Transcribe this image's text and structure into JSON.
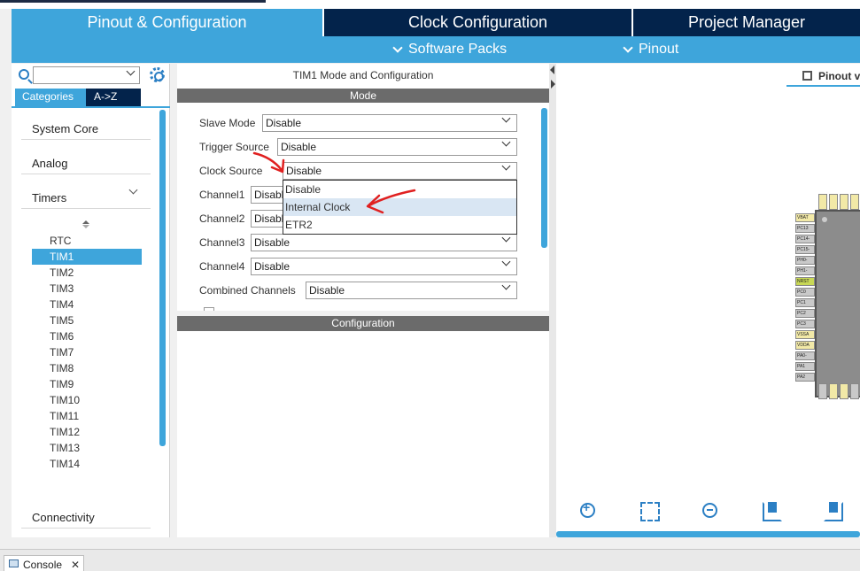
{
  "top_tabs": [
    {
      "label": "Pinout & Configuration"
    },
    {
      "label": "Clock Configuration"
    },
    {
      "label": "Project Manager"
    }
  ],
  "sub_menu": {
    "software_packs": "Software Packs",
    "pinout": "Pinout"
  },
  "sidebar": {
    "search_placeholder": "",
    "categories_label": "Categories",
    "az_label": "A->Z",
    "groups": [
      {
        "label": "System Core"
      },
      {
        "label": "Analog"
      },
      {
        "label": "Timers"
      },
      {
        "label": "Connectivity"
      }
    ],
    "timers": [
      "RTC",
      "TIM1",
      "TIM2",
      "TIM3",
      "TIM4",
      "TIM5",
      "TIM6",
      "TIM7",
      "TIM8",
      "TIM9",
      "TIM10",
      "TIM11",
      "TIM12",
      "TIM13",
      "TIM14"
    ],
    "selected_timer": "TIM1"
  },
  "mode_panel": {
    "title": "TIM1 Mode and Configuration",
    "mode_header": "Mode",
    "config_header": "Configuration",
    "fields": [
      {
        "label": "Slave Mode",
        "value": "Disable"
      },
      {
        "label": "Trigger Source",
        "value": "Disable"
      },
      {
        "label": "Clock Source",
        "value": "Disable"
      },
      {
        "label": "Channel1",
        "value": "Disable"
      },
      {
        "label": "Channel2",
        "value": "Disable"
      },
      {
        "label": "Channel3",
        "value": "Disable"
      },
      {
        "label": "Channel4",
        "value": "Disable"
      },
      {
        "label": "Combined Channels",
        "value": "Disable"
      }
    ],
    "dropdown_options": [
      "Disable",
      "Internal Clock",
      "ETR2"
    ],
    "dropdown_highlighted": "Internal Clock"
  },
  "pinout_view": {
    "tab_label": "Pinout v",
    "left_pins": [
      "VBAT",
      "PC13",
      "PC14-",
      "PC15-",
      "PH0-",
      "PH1-",
      "NRST",
      "PC0",
      "PC1",
      "PC2",
      "PC3",
      "VSSA",
      "VDDA",
      "PA0-",
      "PA1",
      "PA2"
    ]
  },
  "console": {
    "label": "Console"
  },
  "colors": {
    "accent": "#3ea5db",
    "navy": "#03234b",
    "annotation": "#e02020"
  }
}
